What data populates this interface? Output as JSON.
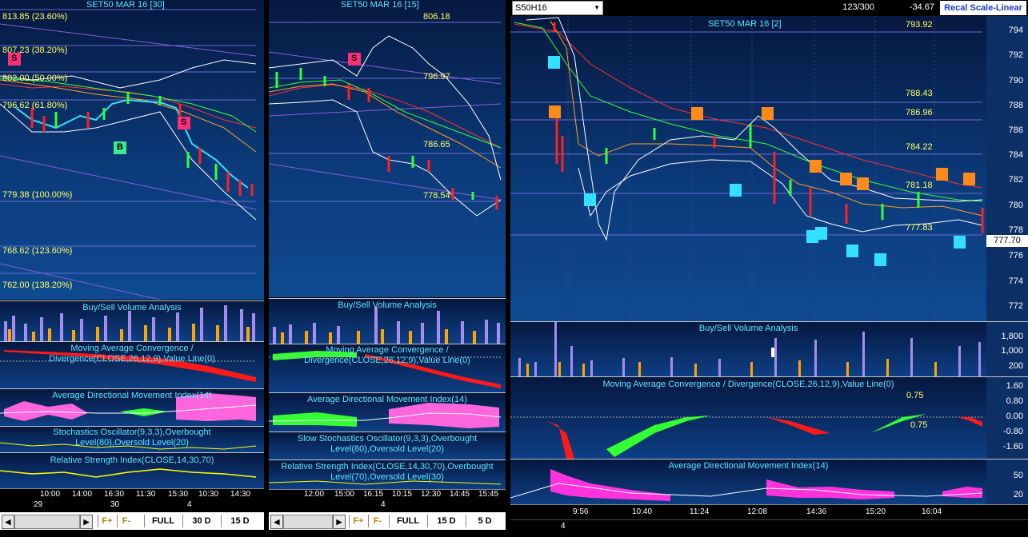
{
  "panels": {
    "p1": {
      "title": "SET50 MAR 16  [30]",
      "fib_labels": [
        "813.85 (23.60%)",
        "807.23 (38.20%)",
        "802.00 (50.00%)",
        "796.62 (61.80%)",
        "779.38 (100.00%)",
        "768.62 (123.60%)",
        "762.00 (138.20%)"
      ],
      "signals": [
        "S",
        "S",
        "B"
      ],
      "sub_volume": "Buy/Sell Volume Analysis",
      "sub_macd": "Moving Average Convergence / Divergence(CLOSE,26,12,9),Value Line(0)",
      "sub_adx": "Average Directional Movement Index(14)",
      "sub_stoch": "Stochastics Oscillator(9,3,3),Overbought Level(80),Oversold Level(20)",
      "sub_rsi": "Relative Strength Index(CLOSE,14,30,70)",
      "times": [
        "10:00",
        "14:00",
        "16:30",
        "11:30",
        "15:30",
        "10:30",
        "14:30"
      ],
      "dates": [
        "29",
        "30",
        "4"
      ],
      "buttons": [
        "FULL",
        "30 D",
        "15 D"
      ],
      "fplus": "F+",
      "fminus": "F-"
    },
    "p2": {
      "title": "SET50 MAR 16  [15]",
      "price_labels": [
        "806.18",
        "796.97",
        "786.65",
        "778.54"
      ],
      "signals": [
        "S"
      ],
      "sub_volume": "Buy/Sell Volume Analysis",
      "sub_macd": "Moving Average Convergence / Divergence(CLOSE,26,12,9),Value Line(0)",
      "sub_adx": "Average Directional Movement Index(14)",
      "sub_stoch": "Slow Stochastics Oscillator(9,3,3),Overbought Level(80),Oversold Level(20)",
      "sub_rsi": "Relative Strength Index(CLOSE,14,30,70),Overbought Level(70),Oversold Level(30)",
      "times": [
        "12:00",
        "15:00",
        "16:15",
        "10:15",
        "12:30",
        "14:45",
        "15:45"
      ],
      "dates": [
        "4"
      ],
      "buttons": [
        "FULL",
        "15 D",
        "5 D"
      ],
      "fplus": "F+",
      "fminus": "F-"
    },
    "p3": {
      "symbol_select": "S50H16",
      "bar_counter": "123/300",
      "change_value": "-34.67",
      "recal_label": "Recal Scale-Linear",
      "title": "SET50 MAR 16  [2]",
      "price_labels": [
        "793.92",
        "788.43",
        "786.96",
        "784.22",
        "781.18",
        "777.83"
      ],
      "last_price": "777.70",
      "y_scale": [
        "794",
        "792",
        "790",
        "788",
        "786",
        "784",
        "782",
        "780",
        "778",
        "776",
        "774",
        "772"
      ],
      "sub_volume": "Buy/Sell Volume Analysis",
      "vol_scale": [
        "1,800",
        "1,000",
        "200"
      ],
      "sub_macd": "Moving Average Convergence / Divergence(CLOSE,26,12,9),Value Line(0)",
      "macd_labels": [
        "0.75",
        "0.75"
      ],
      "macd_scale": [
        "1.60",
        "0.80",
        "0.00",
        "-0.80",
        "-1.60"
      ],
      "sub_adx": "Average Directional Movement Index(14)",
      "adx_scale": [
        "50",
        "20"
      ],
      "times": [
        "9:56",
        "10:40",
        "11:24",
        "12:08",
        "14:36",
        "15:20",
        "16:04"
      ],
      "dates": [
        "4"
      ]
    }
  },
  "colors": {
    "title": "#5fe3ff",
    "fib": "#ffff66",
    "sell_signal_p1": "#ff2e7a",
    "buy_signal": "#33e0ff",
    "sell_signal_p3": "#ff8a1c",
    "candle_up": "#33ff33",
    "candle_down": "#ff2020"
  }
}
